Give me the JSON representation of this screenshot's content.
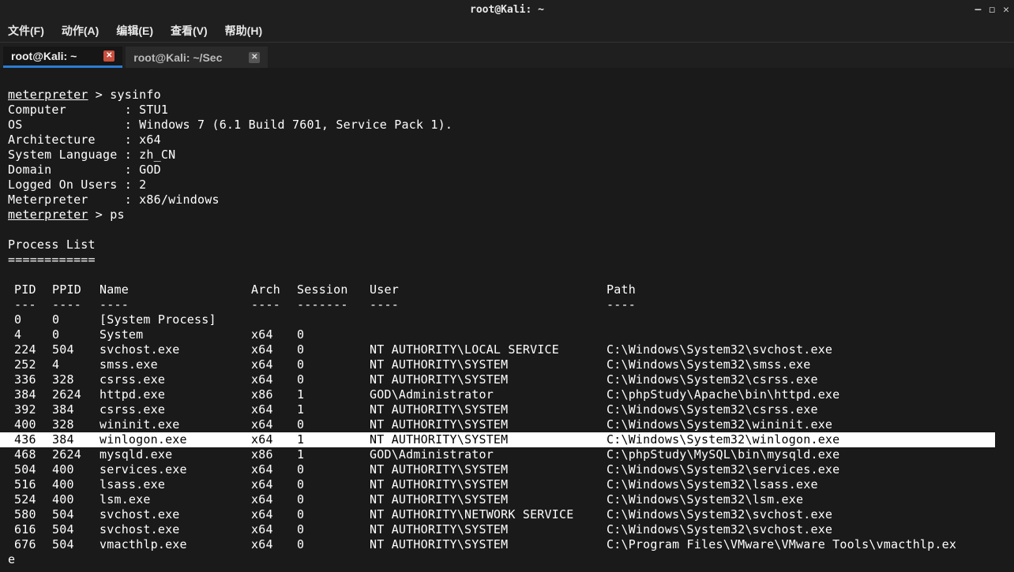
{
  "window": {
    "title": "root@Kali: ~"
  },
  "menu": {
    "file": "文件(F)",
    "actions": "动作(A)",
    "edit": "编辑(E)",
    "view": "查看(V)",
    "help": "帮助(H)"
  },
  "tabs": [
    {
      "label": "root@Kali: ~",
      "active": true
    },
    {
      "label": "root@Kali: ~/Sec",
      "active": false
    }
  ],
  "session": {
    "prompt_host": "meterpreter",
    "prompt_sep": " > ",
    "cmd_sysinfo": "sysinfo",
    "cmd_ps": "ps",
    "sysinfo": [
      {
        "k": "Computer        ",
        "v": ": STU1"
      },
      {
        "k": "OS              ",
        "v": ": Windows 7 (6.1 Build 7601, Service Pack 1)."
      },
      {
        "k": "Architecture    ",
        "v": ": x64"
      },
      {
        "k": "System Language ",
        "v": ": zh_CN"
      },
      {
        "k": "Domain          ",
        "v": ": GOD"
      },
      {
        "k": "Logged On Users ",
        "v": ": 2"
      },
      {
        "k": "Meterpreter     ",
        "v": ": x86/windows"
      }
    ],
    "ps_title": "Process List",
    "ps_underline": "============",
    "headers": {
      "pid": "PID",
      "ppid": "PPID",
      "name": "Name",
      "arch": "Arch",
      "session": "Session",
      "user": "User",
      "path": "Path"
    },
    "hsep": {
      "pid": "---",
      "ppid": "----",
      "name": "----",
      "arch": "----",
      "session": "-------",
      "user": "----",
      "path": "----"
    },
    "processes": [
      {
        "pid": "0",
        "ppid": "0",
        "name": "[System Process]",
        "arch": "",
        "sess": "",
        "user": "",
        "path": ""
      },
      {
        "pid": "4",
        "ppid": "0",
        "name": "System",
        "arch": "x64",
        "sess": "0",
        "user": "",
        "path": ""
      },
      {
        "pid": "224",
        "ppid": "504",
        "name": "svchost.exe",
        "arch": "x64",
        "sess": "0",
        "user": "NT AUTHORITY\\LOCAL SERVICE",
        "path": "C:\\Windows\\System32\\svchost.exe"
      },
      {
        "pid": "252",
        "ppid": "4",
        "name": "smss.exe",
        "arch": "x64",
        "sess": "0",
        "user": "NT AUTHORITY\\SYSTEM",
        "path": "C:\\Windows\\System32\\smss.exe"
      },
      {
        "pid": "336",
        "ppid": "328",
        "name": "csrss.exe",
        "arch": "x64",
        "sess": "0",
        "user": "NT AUTHORITY\\SYSTEM",
        "path": "C:\\Windows\\System32\\csrss.exe"
      },
      {
        "pid": "384",
        "ppid": "2624",
        "name": "httpd.exe",
        "arch": "x86",
        "sess": "1",
        "user": "GOD\\Administrator",
        "path": "C:\\phpStudy\\Apache\\bin\\httpd.exe"
      },
      {
        "pid": "392",
        "ppid": "384",
        "name": "csrss.exe",
        "arch": "x64",
        "sess": "1",
        "user": "NT AUTHORITY\\SYSTEM",
        "path": "C:\\Windows\\System32\\csrss.exe"
      },
      {
        "pid": "400",
        "ppid": "328",
        "name": "wininit.exe",
        "arch": "x64",
        "sess": "0",
        "user": "NT AUTHORITY\\SYSTEM",
        "path": "C:\\Windows\\System32\\wininit.exe"
      },
      {
        "pid": "436",
        "ppid": "384",
        "name": "winlogon.exe",
        "arch": "x64",
        "sess": "1",
        "user": "NT AUTHORITY\\SYSTEM",
        "path": "C:\\Windows\\System32\\winlogon.exe",
        "hl": true
      },
      {
        "pid": "468",
        "ppid": "2624",
        "name": "mysqld.exe",
        "arch": "x86",
        "sess": "1",
        "user": "GOD\\Administrator",
        "path": "C:\\phpStudy\\MySQL\\bin\\mysqld.exe"
      },
      {
        "pid": "504",
        "ppid": "400",
        "name": "services.exe",
        "arch": "x64",
        "sess": "0",
        "user": "NT AUTHORITY\\SYSTEM",
        "path": "C:\\Windows\\System32\\services.exe"
      },
      {
        "pid": "516",
        "ppid": "400",
        "name": "lsass.exe",
        "arch": "x64",
        "sess": "0",
        "user": "NT AUTHORITY\\SYSTEM",
        "path": "C:\\Windows\\System32\\lsass.exe"
      },
      {
        "pid": "524",
        "ppid": "400",
        "name": "lsm.exe",
        "arch": "x64",
        "sess": "0",
        "user": "NT AUTHORITY\\SYSTEM",
        "path": "C:\\Windows\\System32\\lsm.exe"
      },
      {
        "pid": "580",
        "ppid": "504",
        "name": "svchost.exe",
        "arch": "x64",
        "sess": "0",
        "user": "NT AUTHORITY\\NETWORK SERVICE",
        "path": "C:\\Windows\\System32\\svchost.exe"
      },
      {
        "pid": "616",
        "ppid": "504",
        "name": "svchost.exe",
        "arch": "x64",
        "sess": "0",
        "user": "NT AUTHORITY\\SYSTEM",
        "path": "C:\\Windows\\System32\\svchost.exe"
      },
      {
        "pid": "676",
        "ppid": "504",
        "name": "vmacthlp.exe",
        "arch": "x64",
        "sess": "0",
        "user": "NT AUTHORITY\\SYSTEM",
        "path": "C:\\Program Files\\VMware\\VMware Tools\\vmacthlp.ex"
      }
    ],
    "trailing": "e"
  }
}
